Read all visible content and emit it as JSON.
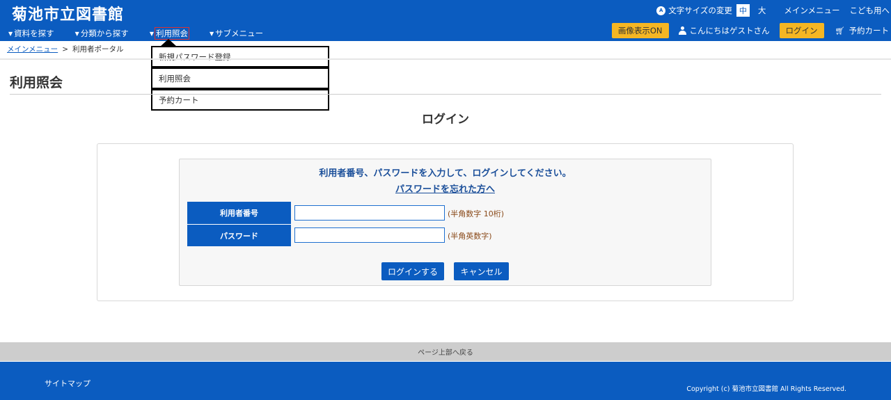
{
  "header": {
    "title": "菊池市立図書館",
    "font_icon": "A",
    "font_size_label": "文字サイズの変更",
    "font_mid": "中",
    "font_large": "大",
    "main_menu": "メインメニュー",
    "kids": "こども用へ",
    "image_toggle": "画像表示ON",
    "greeting": "こんにちはゲストさん",
    "login": "ログイン",
    "cart": "予約カート"
  },
  "nav": {
    "items": [
      {
        "label": "資料を探す"
      },
      {
        "label": "分類から探す"
      },
      {
        "label": "利用照会"
      },
      {
        "label": "サブメニュー"
      }
    ]
  },
  "dropdown": {
    "items": [
      "新規パスワード登録",
      "利用照会",
      "予約カート"
    ]
  },
  "breadcrumb": {
    "home": "メインメニュー",
    "separator": ">",
    "current": "利用者ポータル"
  },
  "page": {
    "title": "利用照会",
    "login_heading": "ログイン",
    "instruction": "利用者番号、パスワードを入力して、ログインしてください。",
    "forgot": "パスワードを忘れた方へ"
  },
  "form": {
    "user_label": "利用者番号",
    "user_value": "",
    "user_hint": "(半角数字 10桁)",
    "pass_label": "パスワード",
    "pass_value": "",
    "pass_hint": "(半角英数字)",
    "login_button": "ログインする",
    "cancel_button": "キャンセル"
  },
  "footer": {
    "back_to_top": "ページ上部へ戻る",
    "sitemap": "サイトマップ",
    "copyright": "Copyright (c) 菊池市立図書館 All Rights Reserved."
  },
  "colors": {
    "primary": "#0b5cc0",
    "accent": "#f5b623",
    "link": "#1b4f9a"
  }
}
